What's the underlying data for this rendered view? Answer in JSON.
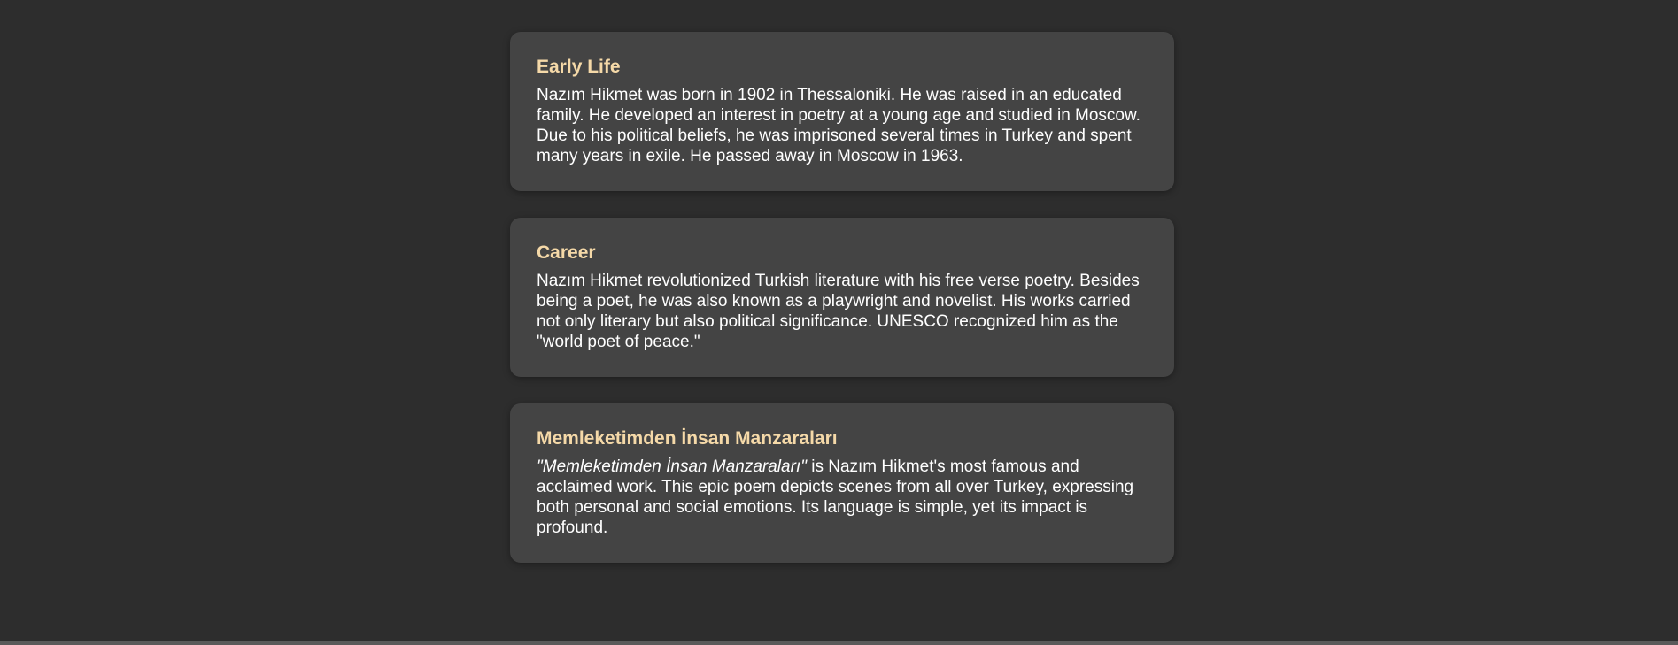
{
  "sections": [
    {
      "title": "Early Life",
      "emphasis": "",
      "body": "Nazım Hikmet was born in 1902 in Thessaloniki. He was raised in an educated family. He developed an interest in poetry at a young age and studied in Moscow. Due to his political beliefs, he was imprisoned several times in Turkey and spent many years in exile. He passed away in Moscow in 1963."
    },
    {
      "title": "Career",
      "emphasis": "",
      "body": "Nazım Hikmet revolutionized Turkish literature with his free verse poetry. Besides being a poet, he was also known as a playwright and novelist. His works carried not only literary but also political significance. UNESCO recognized him as the \"world poet of peace.\""
    },
    {
      "title": "Memleketimden İnsan Manzaraları",
      "emphasis": "\"Memleketimden İnsan Manzaraları\"",
      "body": " is Nazım Hikmet's most famous and acclaimed work. This epic poem depicts scenes from all over Turkey, expressing both personal and social emotions. Its language is simple, yet its impact is profound."
    }
  ],
  "colors": {
    "background": "#2d2d2d",
    "card": "#444444",
    "heading": "#f5d9a8",
    "text": "#ffffff"
  }
}
